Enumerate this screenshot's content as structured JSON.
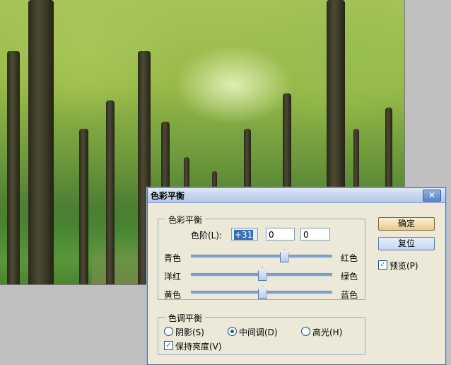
{
  "dialog": {
    "title": "色彩平衡",
    "close_icon": "close-x-icon"
  },
  "color_balance": {
    "legend": "色彩平衡",
    "levels_label": "色阶(L):",
    "levels": [
      "+31",
      "0",
      "0"
    ],
    "sliders": [
      {
        "left": "青色",
        "right": "红色",
        "value": 31
      },
      {
        "left": "洋红",
        "right": "绿色",
        "value": 0
      },
      {
        "left": "黄色",
        "right": "蓝色",
        "value": 0
      }
    ],
    "range": [
      -100,
      100
    ]
  },
  "tone_balance": {
    "legend": "色调平衡",
    "shadows": "阴影(S)",
    "midtones": "中间调(D)",
    "highlights": "高光(H)",
    "selected": "midtones",
    "preserve_luminosity": "保持亮度(V)",
    "preserve_checked": true
  },
  "buttons": {
    "ok": "确定",
    "reset": "复位"
  },
  "preview": {
    "label": "预览(P)",
    "checked": true
  }
}
